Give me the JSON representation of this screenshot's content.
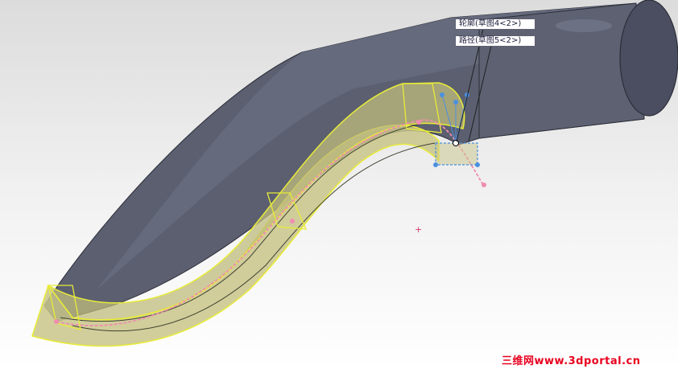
{
  "viewport": {
    "background_top": "#dcdcdc",
    "background_bottom": "#ffffff"
  },
  "model": {
    "body_color": "#5b5f70",
    "cap_color": "#4a4e60",
    "preview_color": "#e8ec38",
    "preview_fill": "#c9c58a",
    "path_color": "#f08cb0",
    "handle_color": "#4a90e0"
  },
  "callouts": [
    {
      "label": "轮廓(草图4<2>)"
    },
    {
      "label": "路径(草图5<2>)"
    }
  ],
  "origin_marker": "+",
  "watermark": "三维网www.3dportal.cn"
}
